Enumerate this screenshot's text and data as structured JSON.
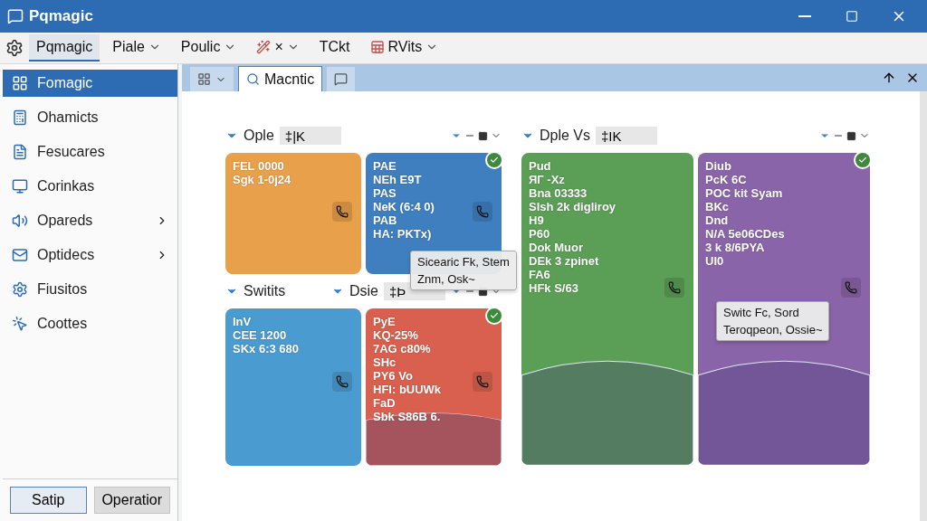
{
  "window": {
    "title": "Pqmagic"
  },
  "menu": [
    {
      "kind": "text",
      "label": "Pqmagic",
      "selected": true,
      "dropdown": false
    },
    {
      "kind": "text",
      "label": "Piale",
      "selected": false,
      "dropdown": true
    },
    {
      "kind": "text",
      "label": "Poulic",
      "selected": false,
      "dropdown": true
    },
    {
      "kind": "tool",
      "label": "×",
      "selected": false,
      "dropdown": true
    },
    {
      "kind": "text",
      "label": "TCkt",
      "selected": false,
      "dropdown": false
    },
    {
      "kind": "sheet",
      "label": "RVits",
      "selected": false,
      "dropdown": true
    }
  ],
  "sidebar": {
    "items": [
      {
        "label": "Fomagic",
        "selected": true,
        "submenu": false
      },
      {
        "label": "Ohamicts",
        "selected": false,
        "submenu": false
      },
      {
        "label": "Fesucares",
        "selected": false,
        "submenu": false
      },
      {
        "label": "Corinkas",
        "selected": false,
        "submenu": false
      },
      {
        "label": "Opareds",
        "selected": false,
        "submenu": true
      },
      {
        "label": "Optidecs",
        "selected": false,
        "submenu": true
      },
      {
        "label": "Fiusitos",
        "selected": false,
        "submenu": false
      },
      {
        "label": "Coottes",
        "selected": false,
        "submenu": false
      }
    ],
    "buttons": [
      "Satip",
      "Operatior"
    ]
  },
  "tabs": [
    {
      "kind": "layout",
      "selected": false
    },
    {
      "kind": "search",
      "label": "Macntic",
      "selected": true
    },
    {
      "kind": "chat",
      "selected": false
    }
  ],
  "groups": [
    {
      "headers": [
        {
          "title": "Ople",
          "field": "‡|K",
          "controls": true
        }
      ],
      "rows": [
        [
          {
            "color": "#e8a04a",
            "kind": "plain",
            "checked": false,
            "lines": [
              "FEL 0000",
              "Sgk 1-0j24"
            ]
          },
          {
            "color": "#3f7fc0",
            "kind": "plain",
            "checked": true,
            "lines": [
              "PAE",
              "NEh E9T",
              "PAS",
              "NeK (6:4 0)",
              "PAB",
              "HA: PKTx)"
            ]
          }
        ]
      ],
      "headers2": [
        {
          "title": "Switits",
          "controls": false
        },
        {
          "title": "Dsie",
          "field": "‡Þ",
          "controls": true
        }
      ],
      "rows2": [
        [
          {
            "color": "#4a9bd0",
            "kind": "plain",
            "checked": false,
            "lines": [
              "InV",
              "CEE 1200",
              "SKx 6:3 680"
            ]
          },
          {
            "color": "#d9604e",
            "kind": "arc",
            "checked": true,
            "lines": [
              "PyE",
              "KQ-25%",
              "7AG c80%",
              "SHc",
              "PY6 Vo",
              "HFI: bUUWk",
              "FaD",
              "Sbk S86B 6."
            ]
          }
        ]
      ]
    },
    {
      "headers": [
        {
          "title": "Dple Vs",
          "field": "‡IK",
          "controls": true
        }
      ],
      "rows": [
        [
          {
            "color": "#5b9e55",
            "kind": "arc",
            "checked": false,
            "lines": [
              "Pud",
              "ЯГ -Xz",
              "Bna 03333",
              "Slsh 2k digliroy",
              "H9",
              "P60",
              "Dok Muor",
              "DEk 3 zpinet",
              "FA6",
              "HFk S/63"
            ]
          },
          {
            "color": "#8a64a8",
            "kind": "arc",
            "checked": true,
            "lines": [
              "Diub",
              "PcK 6C",
              "POC kit Syam",
              "BKc",
              "Dnd",
              "N/A 5e06CDes",
              "3 k 8/6PYA",
              "UI0"
            ]
          }
        ]
      ]
    }
  ],
  "tooltips": [
    [
      "Sicearic Fk, Stem",
      "Znm, Osk~"
    ],
    [
      "Switc Fc, Sord",
      "Teroqpeon, Ossie~"
    ]
  ]
}
